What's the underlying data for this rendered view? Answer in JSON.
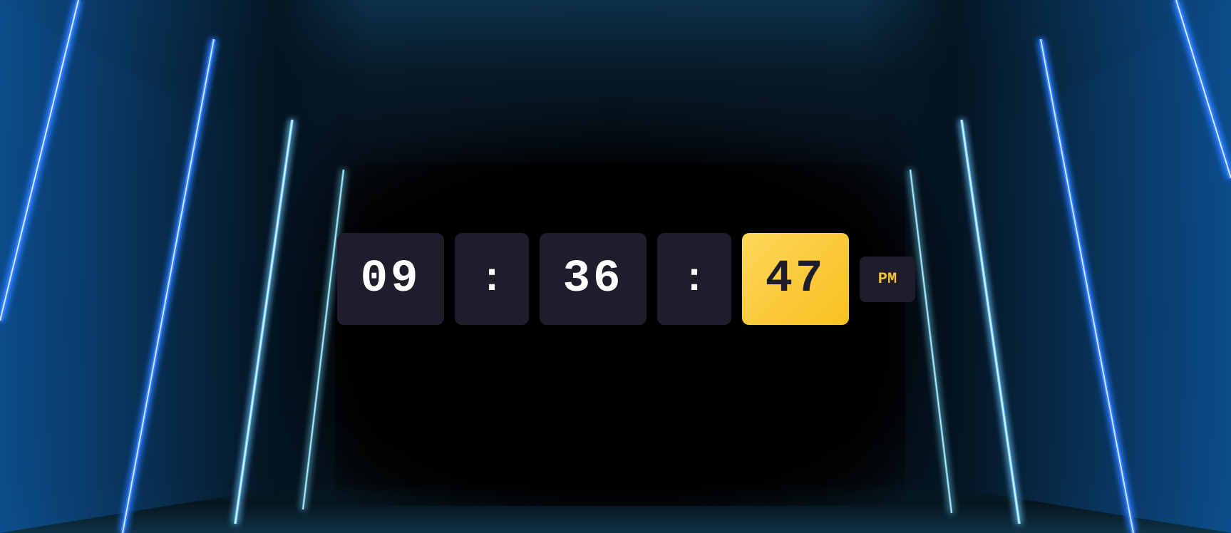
{
  "clock": {
    "hours": "09",
    "separator_1": ":",
    "minutes": "36",
    "separator_2": ":",
    "seconds": "47",
    "period": "PM"
  },
  "colors": {
    "tile_background": "#1f1d2b",
    "digit_color": "#ffffff",
    "seconds_highlight": "#fbc93a",
    "period_color": "#f5c22c",
    "neon_blue": "#2f7bff",
    "neon_cyan": "#7fe0ff"
  },
  "background": {
    "scene": "neon-tunnel"
  }
}
